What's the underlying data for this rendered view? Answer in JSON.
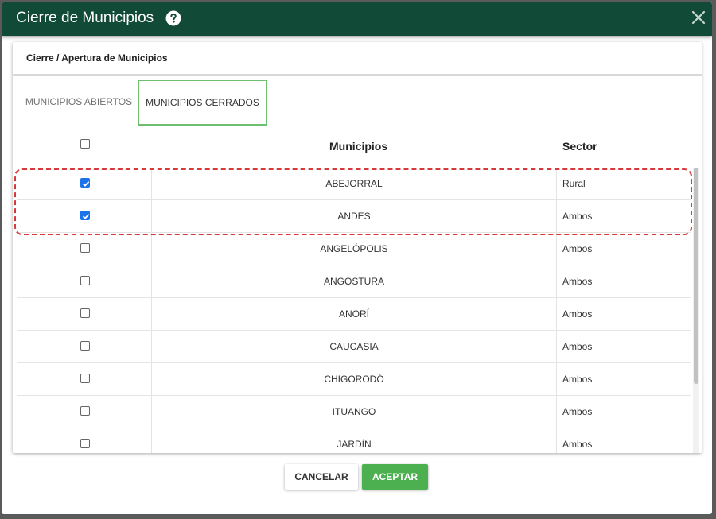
{
  "dialog": {
    "title": "Cierre de Municipios",
    "help_icon": "help-circle-icon",
    "close_icon": "close-icon"
  },
  "card": {
    "header": "Cierre / Apertura de Municipios"
  },
  "tabs": [
    {
      "label": "MUNICIPIOS ABIERTOS",
      "active": false
    },
    {
      "label": "MUNICIPIOS CERRADOS",
      "active": true
    }
  ],
  "table": {
    "columns": [
      "Municipios",
      "Sector"
    ],
    "select_all_checked": false,
    "rows": [
      {
        "municipio": "ABEJORRAL",
        "sector": "Rural",
        "checked": true
      },
      {
        "municipio": "ANDES",
        "sector": "Ambos",
        "checked": true
      },
      {
        "municipio": "ANGELÓPOLIS",
        "sector": "Ambos",
        "checked": false
      },
      {
        "municipio": "ANGOSTURA",
        "sector": "Ambos",
        "checked": false
      },
      {
        "municipio": "ANORÍ",
        "sector": "Ambos",
        "checked": false
      },
      {
        "municipio": "CAUCASIA",
        "sector": "Ambos",
        "checked": false
      },
      {
        "municipio": "CHIGORODÓ",
        "sector": "Ambos",
        "checked": false
      },
      {
        "municipio": "ITUANGO",
        "sector": "Ambos",
        "checked": false
      },
      {
        "municipio": "JARDÍN",
        "sector": "Ambos",
        "checked": false
      }
    ]
  },
  "buttons": {
    "cancel": "CANCELAR",
    "accept": "ACEPTAR"
  },
  "colors": {
    "titlebar": "#114a36",
    "accent_green": "#4caf50",
    "checkbox_blue": "#1a73e8",
    "highlight_red": "#d63a3a"
  }
}
